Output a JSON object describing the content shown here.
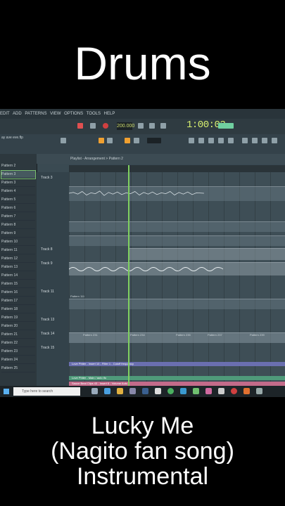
{
  "header": {
    "title": "Drums"
  },
  "caption": {
    "line1": "Lucky Me",
    "line2": "(Nagito fan song)",
    "line3": "Instrumental"
  },
  "app": {
    "menu": [
      "EDIT",
      "ADD",
      "PATTERNS",
      "VIEW",
      "OPTIONS",
      "TOOLS",
      "HELP"
    ],
    "tempo": "200.000",
    "time": "1:00:03",
    "hint": "ay ave eve.flp",
    "playlist_title": "Playlist - Arrangement  > Pattern 2",
    "patterns": [
      "Pattern 2",
      "Pattern 3",
      "Pattern 3",
      "Pattern 4",
      "Pattern 5",
      "Pattern 6",
      "Pattern 7",
      "Pattern 8",
      "Pattern 9",
      "Pattern 10",
      "Pattern 11",
      "Pattern 12",
      "Pattern 13",
      "Pattern 14",
      "Pattern 15",
      "Pattern 16",
      "Pattern 17",
      "Pattern 18",
      "Pattern 19",
      "Pattern 20",
      "Pattern 21",
      "Pattern 22",
      "Pattern 23",
      "Pattern 24",
      "Pattern 25"
    ],
    "tracks": [
      "Track 3",
      "Track 8",
      "Track 9",
      "Track 11",
      "Track 13",
      "Track 14",
      "Track 15"
    ],
    "clips": {
      "p231": "Pattern 231",
      "p234": "Pattern 234",
      "p235": "Pattern 235",
      "p237": "Pattern 237",
      "p239": "Pattern 239",
      "p111": "Pattern 111",
      "auto1": "Love Phiter - Insert 10 - Filter 1 - Cutoff frequency",
      "auto2": "Love Phiter - Main / auto lfo",
      "auto3": "Sauce Beat Clips 43 - Insert 6 - Volume Auto"
    },
    "search_placeholder": "Type here to search"
  }
}
